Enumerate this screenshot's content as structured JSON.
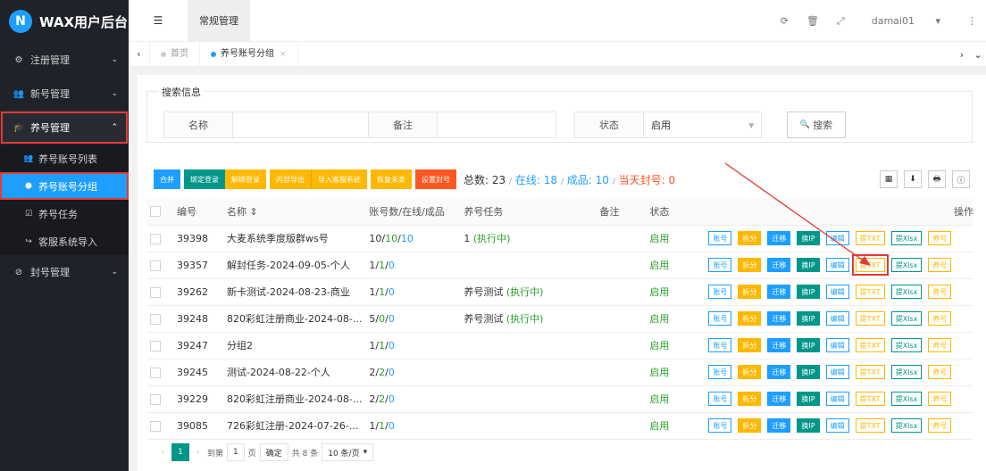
{
  "app": {
    "title": "WAX用户后台",
    "logo_letter": "N"
  },
  "sidebar": {
    "items": [
      {
        "label": "注册管理",
        "icon": "gear-icon",
        "glyph": "⚙",
        "chevron": "⌄"
      },
      {
        "label": "新号管理",
        "icon": "users-icon",
        "glyph": "👥",
        "chevron": "⌄"
      },
      {
        "label": "养号管理",
        "icon": "graduation-cap-icon",
        "glyph": "🎓",
        "chevron": "⌃"
      },
      {
        "label": "封号管理",
        "icon": "block-icon",
        "glyph": "⊘",
        "chevron": "⌄"
      }
    ],
    "subitems": [
      {
        "label": "养号账号列表",
        "icon": "users-icon",
        "glyph": "👥"
      },
      {
        "label": "养号账号分组",
        "icon": "cubes-icon",
        "glyph": "⬢"
      },
      {
        "label": "养号任务",
        "icon": "check-square-icon",
        "glyph": "☑"
      },
      {
        "label": "客服系统导入",
        "icon": "share-icon",
        "glyph": "↪"
      }
    ]
  },
  "topbar": {
    "menu_glyph": "☰",
    "tab": "常规管理",
    "user": "damai01",
    "user_caret": "▾",
    "icons": {
      "refresh": "⟳",
      "trash": "🗑",
      "fullscreen": "⤢",
      "more": "⋮"
    }
  },
  "tabbar": {
    "left": "‹",
    "right": "›",
    "down": "⌄",
    "tabs": [
      {
        "label": "首页"
      },
      {
        "label": "养号账号分组",
        "close": "×"
      }
    ]
  },
  "search": {
    "legend": "搜索信息",
    "fields": [
      {
        "label": "名称",
        "value": ""
      },
      {
        "label": "备注",
        "value": ""
      },
      {
        "label": "状态",
        "value": "启用",
        "caret": "▾"
      }
    ],
    "button": "搜索",
    "button_glyph": "🔍"
  },
  "toolbar": {
    "buttons": [
      {
        "label": "合并",
        "color": "#1e9fff"
      },
      {
        "label": "绑定登录",
        "color": "#009688"
      },
      {
        "label": "解绑登录",
        "color": "#ffb800"
      },
      {
        "label": "内部导出",
        "color": "#ffb800"
      },
      {
        "label": "导入客服系统",
        "color": "#ffb800"
      },
      {
        "label": "恢复未卖",
        "color": "#ffb800"
      },
      {
        "label": "设置封号",
        "color": "#ff5722"
      }
    ],
    "stats": {
      "total_label": "总数:",
      "total": "23",
      "online_label": "在线:",
      "online": "18",
      "done_label": "成品:",
      "done": "10",
      "banned_label": "当天封号:",
      "banned": "0",
      "sep": "/"
    },
    "right_icons": {
      "columns": "▦",
      "export": "⬇",
      "print": "🖶",
      "info": "ⓘ"
    }
  },
  "table": {
    "headers": [
      "编号",
      "名称 ⇕",
      "账号数/在线/成品",
      "养号任务",
      "备注",
      "状态",
      "操作"
    ],
    "ops": [
      {
        "label": "账号",
        "style": "outline-blue"
      },
      {
        "label": "拆分",
        "style": "orange"
      },
      {
        "label": "迁移",
        "style": "blue"
      },
      {
        "label": "换IP",
        "style": "teal"
      },
      {
        "label": "编辑",
        "style": "outline-blue"
      },
      {
        "label": "提TXT",
        "style": "outline-orange"
      },
      {
        "label": "提Xlsx",
        "style": "outline-teal"
      },
      {
        "label": "养号",
        "style": "outline-orange"
      }
    ],
    "rows": [
      {
        "id": "39398",
        "name": "大麦系统季度版群ws号",
        "cnt": "10",
        "online": "10",
        "done": "10",
        "task": "1",
        "task_status": "(执行中)",
        "status": "启用"
      },
      {
        "id": "39357",
        "name": "解封任务-2024-09-05-个人",
        "cnt": "1",
        "online": "1",
        "done": "0",
        "task": "",
        "task_status": "",
        "status": "启用"
      },
      {
        "id": "39262",
        "name": "新卡测试-2024-08-23-商业",
        "cnt": "1",
        "online": "1",
        "done": "0",
        "task": "养号测试",
        "task_status": "(执行中)",
        "status": "启用"
      },
      {
        "id": "39248",
        "name": "820彩虹注册商业-2024-08-...",
        "cnt": "5",
        "online": "0",
        "done": "0",
        "task": "养号测试",
        "task_status": "(执行中)",
        "status": "启用"
      },
      {
        "id": "39247",
        "name": "分组2",
        "cnt": "1",
        "online": "1",
        "done": "0",
        "task": "",
        "task_status": "",
        "status": "启用"
      },
      {
        "id": "39245",
        "name": "测试-2024-08-22-个人",
        "cnt": "2",
        "online": "2",
        "done": "0",
        "task": "",
        "task_status": "",
        "status": "启用"
      },
      {
        "id": "39229",
        "name": "820彩虹注册商业-2024-08-...",
        "cnt": "2",
        "online": "2",
        "done": "0",
        "task": "",
        "task_status": "",
        "status": "启用"
      },
      {
        "id": "39085",
        "name": "726彩虹注册-2024-07-26-...",
        "cnt": "1",
        "online": "1",
        "done": "0",
        "task": "",
        "task_status": "",
        "status": "启用"
      }
    ]
  },
  "pager": {
    "prev": "‹",
    "next": "›",
    "current": "1",
    "goto_label": "到第",
    "goto_value": "1",
    "page_label": "页",
    "confirm": "确定",
    "total": "共 8 条",
    "per_page": "10 条/页",
    "per_caret": "▾"
  },
  "colors": {
    "accent": "#1e9fff",
    "green": "#2ca02c",
    "teal": "#009688",
    "orange": "#ffb800",
    "red": "#ff5722",
    "highlight": "#e53935"
  }
}
